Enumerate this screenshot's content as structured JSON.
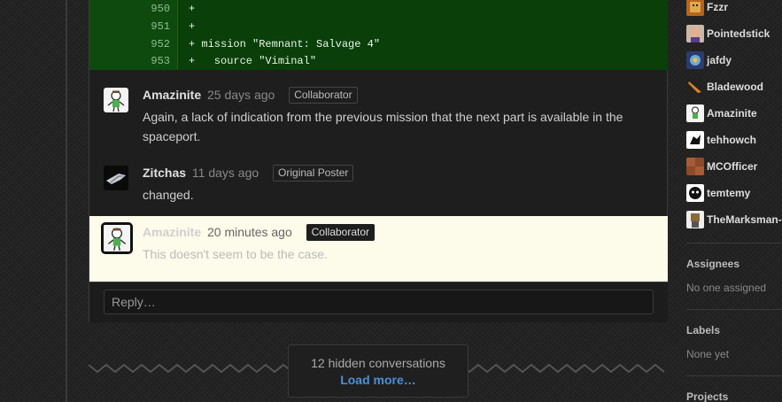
{
  "diff": [
    {
      "num": "950",
      "code": "+"
    },
    {
      "num": "951",
      "code": "+"
    },
    {
      "num": "952",
      "code": "+ mission \"Remnant: Salvage 4\""
    },
    {
      "num": "953",
      "code": "+   source \"Viminal\""
    }
  ],
  "comments": [
    {
      "author": "Amazinite",
      "time": "25 days ago",
      "badge": "Collaborator",
      "body": "Again, a lack of indication from the previous mission that the next part is available in the spaceport."
    },
    {
      "author": "Zitchas",
      "time": "11 days ago",
      "badge": "Original Poster",
      "body": "changed."
    },
    {
      "author": "Amazinite",
      "time": "20 minutes ago",
      "badge": "Collaborator",
      "body": "This doesn't seem to be the case."
    }
  ],
  "reply": {
    "placeholder": "Reply…"
  },
  "hidden": {
    "count_text": "12 hidden conversations",
    "load_more": "Load more…"
  },
  "sidebar": {
    "participants": [
      "Fzzr",
      "Pointedstick",
      "jafdy",
      "Bladewood",
      "Amazinite",
      "tehhowch",
      "MCOfficer",
      "temtemy",
      "TheMarksman-"
    ],
    "assignees": {
      "label": "Assignees",
      "value": "No one assigned"
    },
    "labels": {
      "label": "Labels",
      "value": "None yet"
    },
    "projects": {
      "label": "Projects"
    }
  },
  "colors": {
    "accent_link": "#4a90d9",
    "diff_added_bg": "#0a3f0a",
    "highlight_bg": "#fdfbe9"
  }
}
